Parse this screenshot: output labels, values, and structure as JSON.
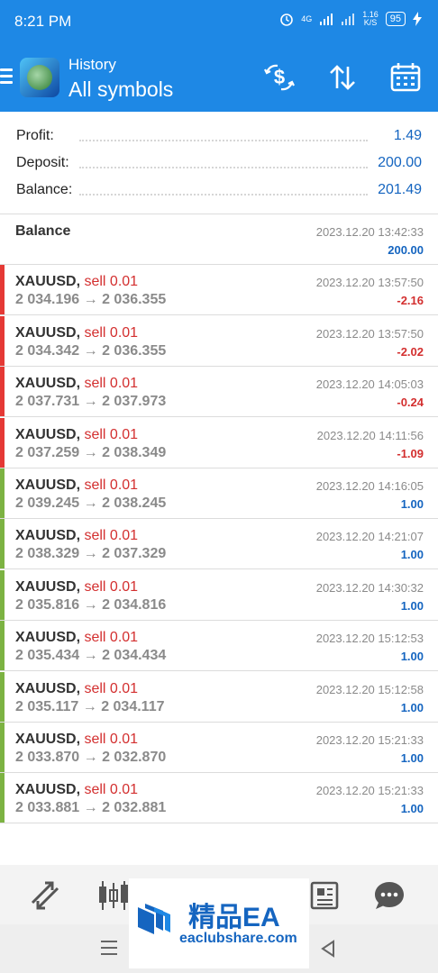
{
  "status": {
    "time": "8:21 PM",
    "network": "4G",
    "speed_value": "1.16",
    "speed_unit": "K/S",
    "battery": "95"
  },
  "header": {
    "subtitle": "History",
    "title": "All symbols"
  },
  "summary": [
    {
      "label": "Profit:",
      "value": "1.49"
    },
    {
      "label": "Deposit:",
      "value": "200.00"
    },
    {
      "label": "Balance:",
      "value": "201.49"
    }
  ],
  "balance_entry": {
    "label": "Balance",
    "time": "2023.12.20 13:42:33",
    "amount": "200.00"
  },
  "trades": [
    {
      "symbol": "XAUUSD,",
      "side": "sell 0.01",
      "prices": "2 034.196 → 2 036.355",
      "time": "2023.12.20 13:57:50",
      "amount": "-2.16",
      "result": "loss"
    },
    {
      "symbol": "XAUUSD,",
      "side": "sell 0.01",
      "prices": "2 034.342 → 2 036.355",
      "time": "2023.12.20 13:57:50",
      "amount": "-2.02",
      "result": "loss"
    },
    {
      "symbol": "XAUUSD,",
      "side": "sell 0.01",
      "prices": "2 037.731 → 2 037.973",
      "time": "2023.12.20 14:05:03",
      "amount": "-0.24",
      "result": "loss"
    },
    {
      "symbol": "XAUUSD,",
      "side": "sell 0.01",
      "prices": "2 037.259 → 2 038.349",
      "time": "2023.12.20 14:11:56",
      "amount": "-1.09",
      "result": "loss"
    },
    {
      "symbol": "XAUUSD,",
      "side": "sell 0.01",
      "prices": "2 039.245 → 2 038.245",
      "time": "2023.12.20 14:16:05",
      "amount": "1.00",
      "result": "profit"
    },
    {
      "symbol": "XAUUSD,",
      "side": "sell 0.01",
      "prices": "2 038.329 → 2 037.329",
      "time": "2023.12.20 14:21:07",
      "amount": "1.00",
      "result": "profit"
    },
    {
      "symbol": "XAUUSD,",
      "side": "sell 0.01",
      "prices": "2 035.816 → 2 034.816",
      "time": "2023.12.20 14:30:32",
      "amount": "1.00",
      "result": "profit"
    },
    {
      "symbol": "XAUUSD,",
      "side": "sell 0.01",
      "prices": "2 035.434 → 2 034.434",
      "time": "2023.12.20 15:12:53",
      "amount": "1.00",
      "result": "profit"
    },
    {
      "symbol": "XAUUSD,",
      "side": "sell 0.01",
      "prices": "2 035.117 → 2 034.117",
      "time": "2023.12.20 15:12:58",
      "amount": "1.00",
      "result": "profit"
    },
    {
      "symbol": "XAUUSD,",
      "side": "sell 0.01",
      "prices": "2 033.870 → 2 032.870",
      "time": "2023.12.20 15:21:33",
      "amount": "1.00",
      "result": "profit"
    },
    {
      "symbol": "XAUUSD,",
      "side": "sell 0.01",
      "prices": "2 033.881 → 2 032.881",
      "time": "2023.12.20 15:21:33",
      "amount": "1.00",
      "result": "profit"
    }
  ],
  "watermark": {
    "brand": "精品EA",
    "url": "eaclubshare.com"
  },
  "icons": {
    "header": [
      "dollar-exchange-icon",
      "sort-icon",
      "calendar-icon"
    ],
    "bottom_nav": [
      "quotes-icon",
      "chart-icon",
      "news-icon",
      "chat-icon"
    ]
  },
  "colors": {
    "header_bg": "#1e88e5",
    "loss_bar": "#e53935",
    "profit_bar": "#7cb342",
    "negative_text": "#d32f2f",
    "positive_text": "#1565c0"
  }
}
